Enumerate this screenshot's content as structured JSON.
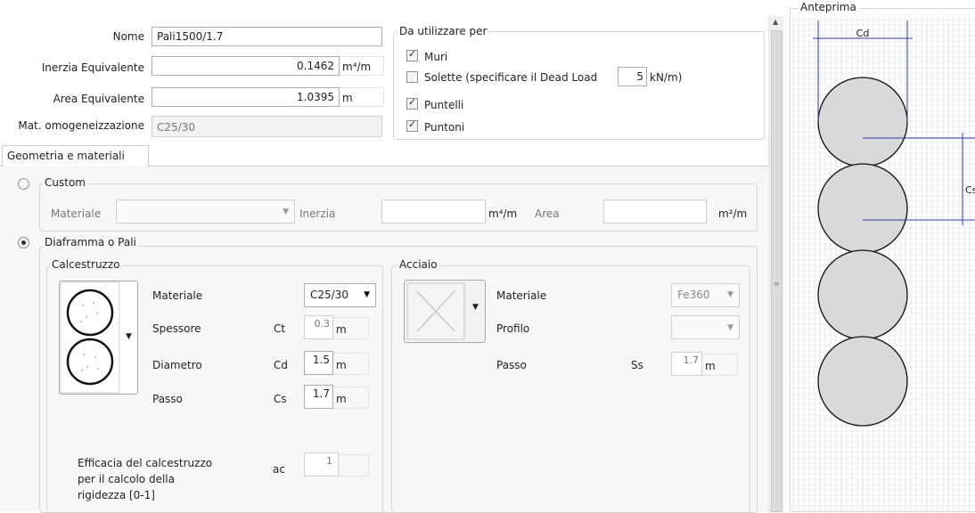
{
  "header": {
    "nome_label": "Nome",
    "nome_value": "Pali1500/1.7",
    "inerzia_label": "Inerzia Equivalente",
    "inerzia_value": "0.1462",
    "inerzia_unit": "m⁴/m",
    "area_label": "Area Equivalente",
    "area_value": "1.0395",
    "area_unit": "m",
    "mat_label": "Mat. omogeneizzazione",
    "mat_value": "C25/30"
  },
  "usage": {
    "title": "Da utilizzare per",
    "items": [
      {
        "label": "Muri",
        "checked": true
      },
      {
        "label": "Solette  (specificare il Dead Load",
        "checked": false
      },
      {
        "label": "Puntelli",
        "checked": true
      },
      {
        "label": "Puntoni",
        "checked": true
      }
    ],
    "dead_load_value": "5",
    "dead_load_unit": "kN/m)"
  },
  "tabs": [
    {
      "label": "Geometria e materiali",
      "active": true
    }
  ],
  "custom": {
    "title": "Custom",
    "selected": false,
    "materiale_label": "Materiale",
    "materiale_value": "",
    "inerzia_label": "Inerzia",
    "inerzia_unit": "m⁴/m",
    "area_label": "Area",
    "area_unit": "m²/m"
  },
  "diaframma": {
    "title": "Diaframma o Pali",
    "selected": true,
    "calcestruzzo": {
      "title": "Calcestruzzo",
      "materiale_label": "Materiale",
      "materiale_value": "C25/30",
      "spessore_label": "Spessore",
      "spessore_sym": "Ct",
      "spessore_value": "0.3",
      "spessore_unit": "m",
      "diametro_label": "Diametro",
      "diametro_sym": "Cd",
      "diametro_value": "1.5",
      "diametro_unit": "m",
      "passo_label": "Passo",
      "passo_sym": "Cs",
      "passo_value": "1.7",
      "passo_unit": "m",
      "efficacia_line1": "Efficacia del calcestruzzo",
      "efficacia_line2": "per il calcolo della",
      "efficacia_line3": "rigidezza  [0-1]",
      "efficacia_sym": "ac",
      "efficacia_value": "1"
    },
    "acciaio": {
      "title": "Acciaio",
      "materiale_label": "Materiale",
      "materiale_value": "Fe360",
      "profilo_label": "Profilo",
      "profilo_value": "",
      "passo_label": "Passo",
      "passo_sym": "Ss",
      "passo_value": "1.7",
      "passo_unit": "m"
    }
  },
  "preview": {
    "title": "Anteprima",
    "cd_label": "Cd",
    "cs_label": "Cs",
    "circle_count": 4,
    "grid_color": "#d6dbe6",
    "dim_color": "#2f3aa5"
  }
}
